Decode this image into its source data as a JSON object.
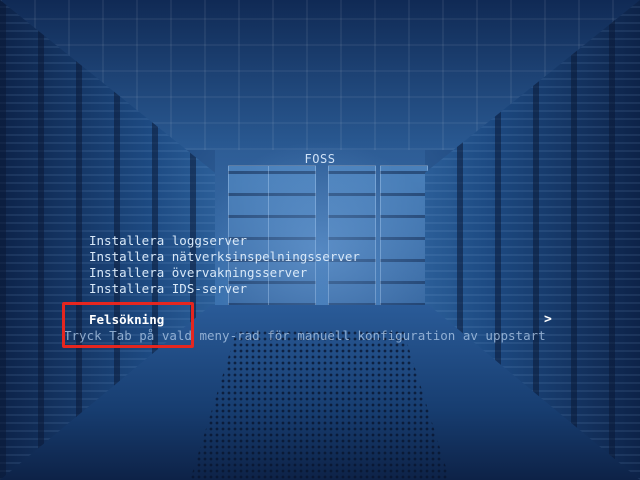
{
  "boot_menu": {
    "title": "FOSS",
    "items": [
      {
        "label": "Installera loggserver"
      },
      {
        "label": "Installera nätverksinspelningsserver"
      },
      {
        "label": "Installera övervakningsserver"
      },
      {
        "label": "Installera IDS-server"
      }
    ],
    "selected_item": {
      "label": "Felsökning",
      "submenu_arrow": ">"
    },
    "hint": "Tryck Tab på vald meny-rad för manuell konfiguration av uppstart"
  },
  "annotation": {
    "highlight_color": "#e5261f"
  }
}
